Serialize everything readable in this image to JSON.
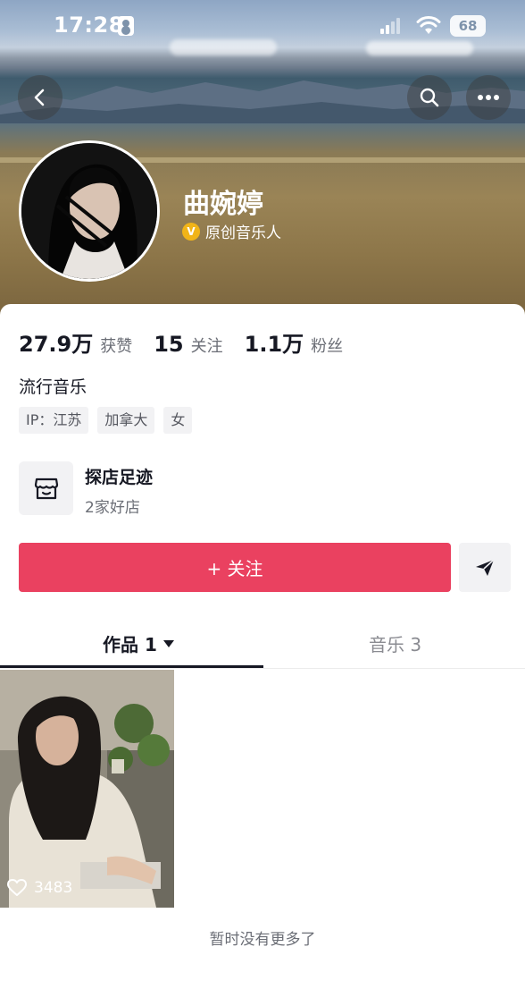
{
  "status_bar": {
    "time": "17:28",
    "battery": "68"
  },
  "header": {
    "back_icon": "chevron-left-icon",
    "search_icon": "search-icon",
    "more_icon": "more-icon"
  },
  "profile": {
    "name": "曲婉婷",
    "verify_badge": "V",
    "verify_text": "原创音乐人",
    "badge_color": "#f1b418"
  },
  "stats": [
    {
      "num": "27.9万",
      "label": "获赞"
    },
    {
      "num": "15",
      "label": "关注"
    },
    {
      "num": "1.1万",
      "label": "粉丝"
    }
  ],
  "bio": "流行音乐",
  "tags": [
    "IP：江苏",
    "加拿大",
    "女"
  ],
  "store": {
    "title": "探店足迹",
    "subtitle": "2家好店"
  },
  "actions": {
    "follow_label": "+ 关注",
    "follow_color": "#ea4160"
  },
  "tabs": {
    "works": "作品 1",
    "music": "音乐 3"
  },
  "videos": [
    {
      "likes": "3483"
    }
  ],
  "footer": {
    "no_more": "暂时没有更多了"
  }
}
